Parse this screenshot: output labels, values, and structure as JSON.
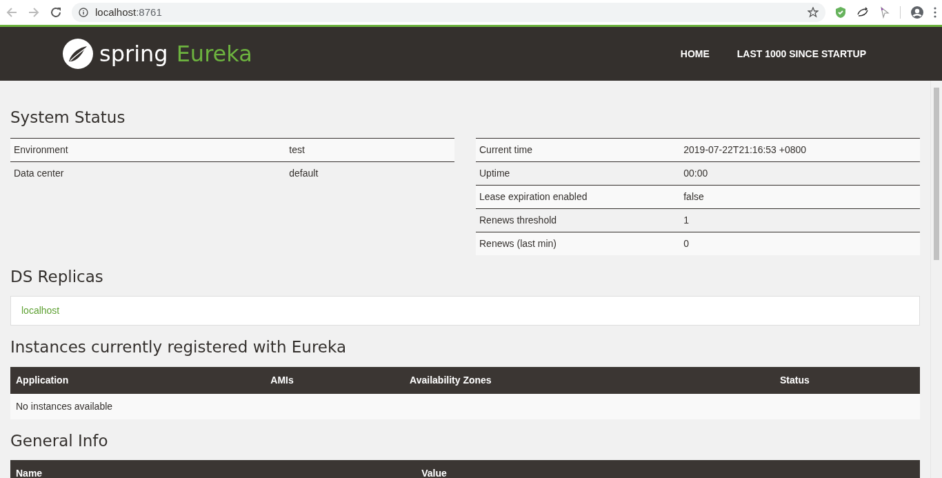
{
  "browser": {
    "url_host": "localhost",
    "url_port": ":8761"
  },
  "header": {
    "brand": "spring",
    "product": "Eureka",
    "nav": [
      {
        "label": "HOME"
      },
      {
        "label": "LAST 1000 SINCE STARTUP"
      }
    ]
  },
  "system_status": {
    "title": "System Status",
    "left_rows": [
      {
        "name": "Environment",
        "value": "test"
      },
      {
        "name": "Data center",
        "value": "default"
      }
    ],
    "right_rows": [
      {
        "name": "Current time",
        "value": "2019-07-22T21:16:53 +0800"
      },
      {
        "name": "Uptime",
        "value": "00:00"
      },
      {
        "name": "Lease expiration enabled",
        "value": "false"
      },
      {
        "name": "Renews threshold",
        "value": "1"
      },
      {
        "name": "Renews (last min)",
        "value": "0"
      }
    ]
  },
  "ds_replicas": {
    "title": "DS Replicas",
    "items": [
      "localhost"
    ]
  },
  "instances": {
    "title": "Instances currently registered with Eureka",
    "columns": [
      "Application",
      "AMIs",
      "Availability Zones",
      "Status"
    ],
    "empty_message": "No instances available"
  },
  "general_info": {
    "title": "General Info",
    "columns": [
      "Name",
      "Value"
    ]
  }
}
